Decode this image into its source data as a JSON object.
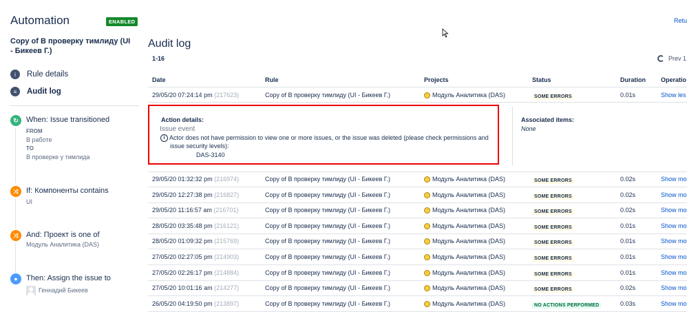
{
  "app": {
    "title": "Automation",
    "status_badge": "ENABLED",
    "rule_name": "Copy of В проверку тимлиду (UI - Бикеев Г.)"
  },
  "nav": [
    {
      "label": "Rule details",
      "icon": "info-icon",
      "active": false
    },
    {
      "label": "Audit log",
      "icon": "list-icon",
      "active": true
    }
  ],
  "components": {
    "trigger": {
      "title": "When: Issue transitioned",
      "from_key": "FROM",
      "from_value": "В работе",
      "to_key": "TO",
      "to_value": "В проверке у тимлида",
      "color": "#36b37e"
    },
    "condition1": {
      "title": "If: Компоненты contains",
      "value": "UI",
      "color": "#ff8b00"
    },
    "condition2": {
      "title": "And: Проект is one of",
      "value": "Модуль Аналитика (DAS)",
      "color": "#ff8b00"
    },
    "action": {
      "title": "Then: Assign the issue to",
      "value": "Геннадий Бикеев",
      "color": "#4c9aff"
    }
  },
  "main": {
    "title": "Audit log",
    "range": "1-16",
    "return_label": "Retu",
    "prev_label": "Prev",
    "page_num": "1"
  },
  "table": {
    "headers": [
      "Date",
      "Rule",
      "Projects",
      "Status",
      "Duration",
      "Operatio"
    ],
    "first_row": {
      "date": "29/05/20 07:24:14 pm",
      "id": "(217623)",
      "rule": "Copy of В проверку тимлиду (UI - Бикеев Г.)",
      "project": "Модуль Аналитика (DAS)",
      "status": "SOME ERRORS",
      "duration": "0.01s",
      "op": "Show les"
    },
    "details": {
      "heading": "Action details:",
      "event": "Issue event",
      "message": "Actor does not have permission to view one or more issues, or the issue was deleted (please check permissions and",
      "message2": "issue security levels):",
      "issue_key": "DAS-3140",
      "assoc_heading": "Associated items:",
      "assoc_value": "None"
    },
    "rows": [
      {
        "date": "29/05/20 01:32:32 pm",
        "id": "(216974)",
        "rule": "Copy of В проверку тимлиду (UI - Бикеев Г.)",
        "project": "Модуль Аналитика (DAS)",
        "status": "SOME ERRORS",
        "duration": "0.02s",
        "op": "Show mo"
      },
      {
        "date": "29/05/20 12:27:38 pm",
        "id": "(216827)",
        "rule": "Copy of В проверку тимлиду (UI - Бикеев Г.)",
        "project": "Модуль Аналитика (DAS)",
        "status": "SOME ERRORS",
        "duration": "0.02s",
        "op": "Show mo"
      },
      {
        "date": "29/05/20 11:16:57 am",
        "id": "(216701)",
        "rule": "Copy of В проверку тимлиду (UI - Бикеев Г.)",
        "project": "Модуль Аналитика (DAS)",
        "status": "SOME ERRORS",
        "duration": "0.02s",
        "op": "Show mo"
      },
      {
        "date": "28/05/20 03:35:48 pm",
        "id": "(216121)",
        "rule": "Copy of В проверку тимлиду (UI - Бикеев Г.)",
        "project": "Модуль Аналитика (DAS)",
        "status": "SOME ERRORS",
        "duration": "0.01s",
        "op": "Show mo"
      },
      {
        "date": "28/05/20 01:09:32 pm",
        "id": "(215769)",
        "rule": "Copy of В проверку тимлиду (UI - Бикеев Г.)",
        "project": "Модуль Аналитика (DAS)",
        "status": "SOME ERRORS",
        "duration": "0.01s",
        "op": "Show mo"
      },
      {
        "date": "27/05/20 02:27:05 pm",
        "id": "(214903)",
        "rule": "Copy of В проверку тимлиду (UI - Бикеев Г.)",
        "project": "Модуль Аналитика (DAS)",
        "status": "SOME ERRORS",
        "duration": "0.01s",
        "op": "Show mo"
      },
      {
        "date": "27/05/20 02:26:17 pm",
        "id": "(214884)",
        "rule": "Copy of В проверку тимлиду (UI - Бикеев Г.)",
        "project": "Модуль Аналитика (DAS)",
        "status": "SOME ERRORS",
        "duration": "0.01s",
        "op": "Show mo"
      },
      {
        "date": "27/05/20 10:01:16 am",
        "id": "(214277)",
        "rule": "Copy of В проверку тимлиду (UI - Бикеев Г.)",
        "project": "Модуль Аналитика (DAS)",
        "status": "SOME ERRORS",
        "duration": "0.02s",
        "op": "Show mo"
      },
      {
        "date": "26/05/20 04:19:50 pm",
        "id": "(213897)",
        "rule": "Copy of В проверку тимлиду (UI - Бикеев Г.)",
        "project": "Модуль Аналитика (DAS)",
        "status": "NO ACTIONS PERFORMED",
        "duration": "0.03s",
        "op": "Show mo"
      }
    ]
  }
}
